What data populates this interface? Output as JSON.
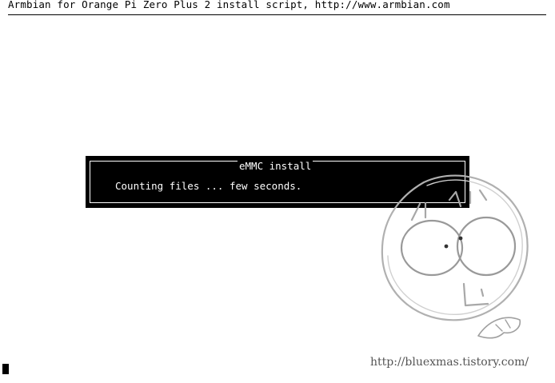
{
  "header": {
    "title": "Armbian for Orange Pi Zero Plus 2 install script, http://www.armbian.com"
  },
  "dialog": {
    "title": "eMMC install",
    "message": "Counting files ... few seconds."
  },
  "watermark": {
    "url": "http://bluexmas.tistory.com/"
  },
  "colors": {
    "background": "#ffffff",
    "dialog_background": "#000000",
    "dialog_text": "#ffffff",
    "watermark": "#555555"
  }
}
